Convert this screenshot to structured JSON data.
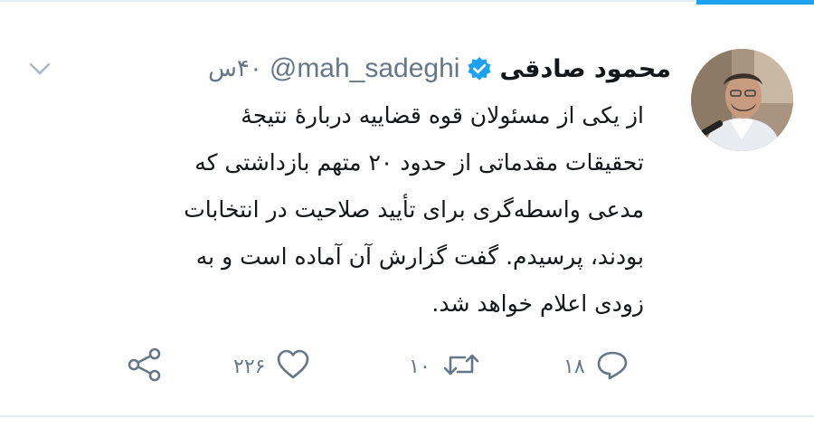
{
  "tweet": {
    "display_name": "محمود صادقی",
    "handle": "@mah_sadeghi",
    "time": "۴۰س",
    "text": "از یکی از مسئولان قوه قضاییه دربارهٔ نتیجهٔ تحقیقات مقدماتی از حدود ۲۰ متهم بازداشتی که مدعی واسطه‌گری برای تأیید صلاحیت در انتخابات بودند، پرسیدم. گفت گزارش آن آماده است و به زودی اعلام خواهد شد.",
    "icons": {
      "verified": "verified-badge-icon",
      "menu": "chevron-down-icon",
      "reply": "reply-icon",
      "retweet": "retweet-icon",
      "like": "heart-icon",
      "share": "share-icon"
    }
  },
  "actions": {
    "reply_count": "۱۸",
    "retweet_count": "۱۰",
    "like_count": "۲۲۶"
  },
  "colors": {
    "accent": "#1da1f2",
    "text": "#14171a",
    "secondary": "#657786",
    "divider": "#e6ecf0"
  }
}
